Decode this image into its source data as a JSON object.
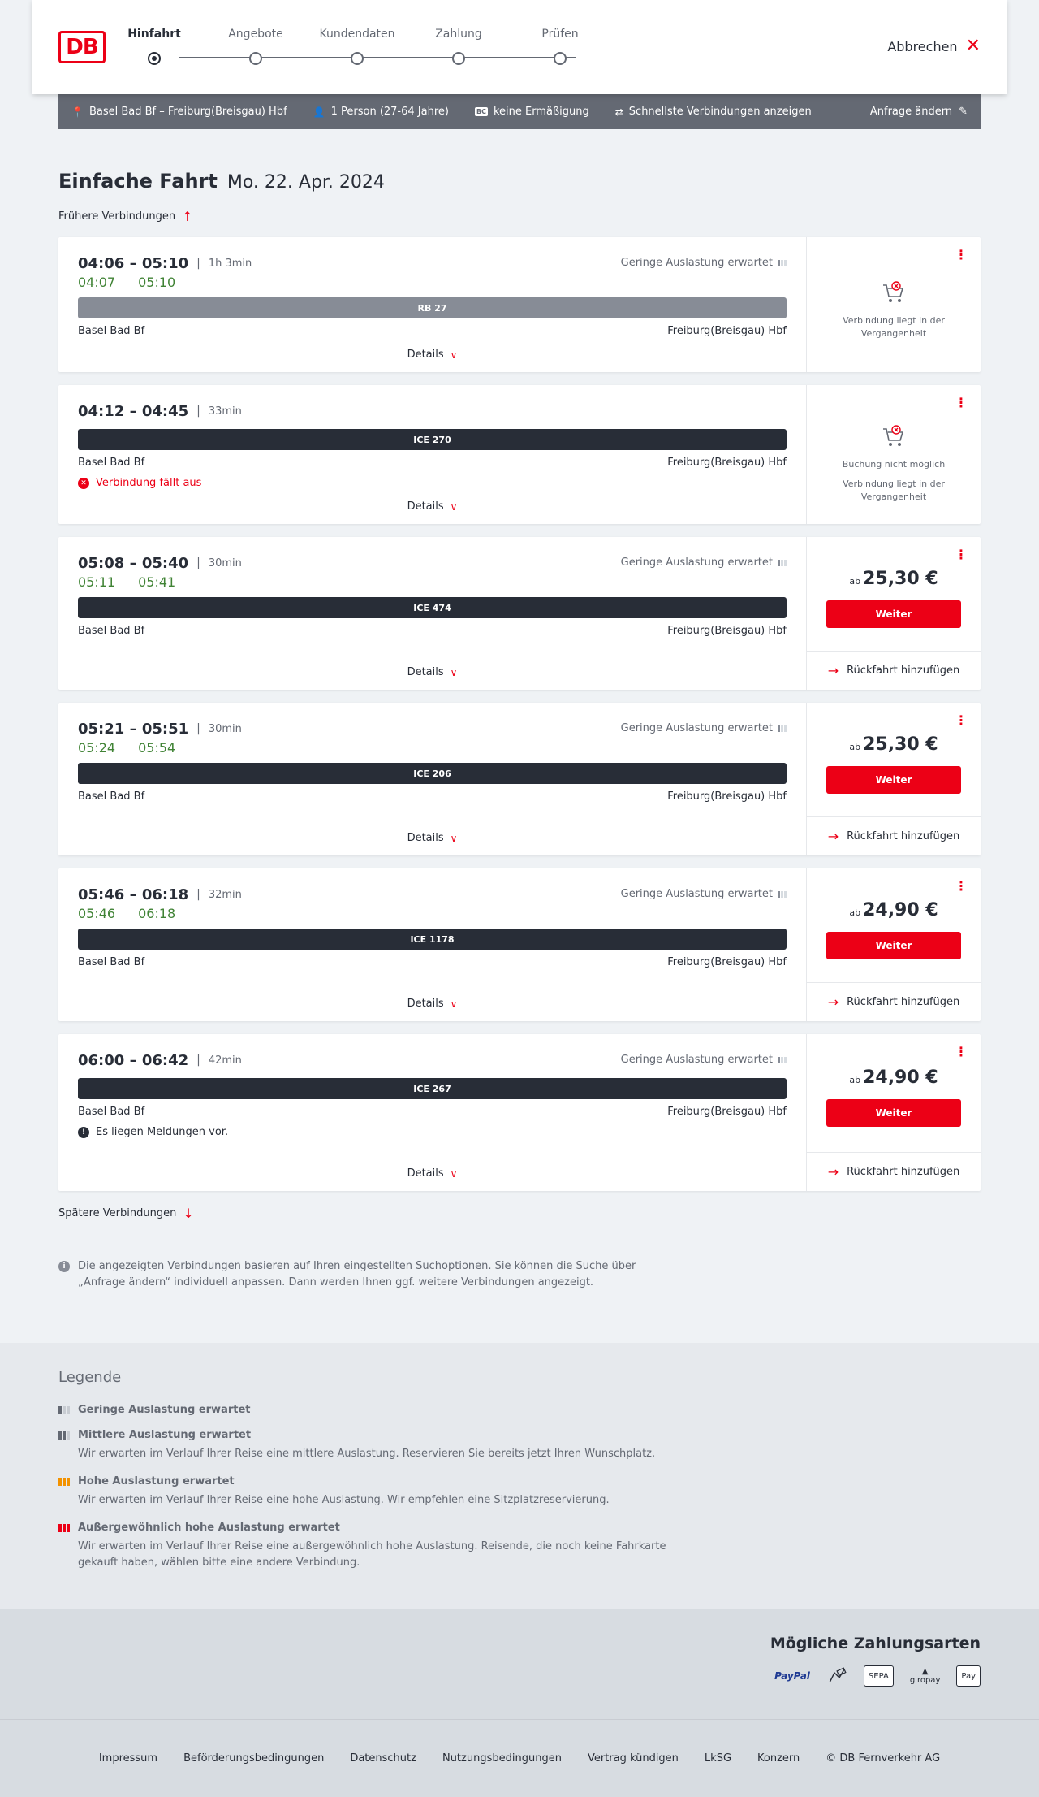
{
  "brand": {
    "logo_text": "DB",
    "accent_color": "#ec0016"
  },
  "stepper": {
    "steps": [
      "Hinfahrt",
      "Angebote",
      "Kundendaten",
      "Zahlung",
      "Prüfen"
    ],
    "active": 0
  },
  "header": {
    "cancel_label": "Abbrechen"
  },
  "search_summary": {
    "route": "Basel Bad Bf – Freiburg(Breisgau) Hbf",
    "passengers": "1 Person (27-64 Jahre)",
    "discount_badge": "BC",
    "discount": "keine Ermäßigung",
    "option": "Schnellste Verbindungen anzeigen",
    "edit_label": "Anfrage ändern"
  },
  "page": {
    "title": "Einfache Fahrt",
    "date": "Mo. 22. Apr. 2024",
    "earlier_label": "Frühere Verbindungen",
    "later_label": "Spätere Verbindungen",
    "note": "Die angezeigten Verbindungen basieren auf Ihren eingestellten Suchoptionen. Sie können die Suche über „Anfrage ändern“ individuell anpassen. Dann werden Ihnen ggf. weitere Verbindungen angezeigt."
  },
  "labels": {
    "details": "Details",
    "weiter": "Weiter",
    "return": "Rückfahrt hinzufügen",
    "price_prefix": "ab",
    "load": "Geringe Auslastung erwartet"
  },
  "connections": [
    {
      "times": "04:06 – 05:10",
      "duration": "1h 3min",
      "realtime_dep": "04:07",
      "realtime_arr": "05:10",
      "train": "RB 27",
      "from": "Basel Bad Bf",
      "to": "Freiburg(Breisgau) Hbf",
      "load": true,
      "message": "",
      "status_lines": [
        "Verbindung liegt in der Vergangenheit"
      ]
    },
    {
      "times": "04:12 – 04:45",
      "duration": "33min",
      "realtime_dep": "",
      "realtime_arr": "",
      "train": "ICE 270",
      "from": "Basel Bad Bf",
      "to": "Freiburg(Breisgau) Hbf",
      "load": false,
      "message": "Verbindung fällt aus",
      "status_lines": [
        "Buchung nicht möglich",
        "Verbindung liegt in der Vergangenheit"
      ]
    },
    {
      "times": "05:08 – 05:40",
      "duration": "30min",
      "realtime_dep": "05:11",
      "realtime_arr": "05:41",
      "train": "ICE 474",
      "from": "Basel Bad Bf",
      "to": "Freiburg(Breisgau) Hbf",
      "load": true,
      "message": "",
      "price": "25,30 €"
    },
    {
      "times": "05:21 – 05:51",
      "duration": "30min",
      "realtime_dep": "05:24",
      "realtime_arr": "05:54",
      "train": "ICE 206",
      "from": "Basel Bad Bf",
      "to": "Freiburg(Breisgau) Hbf",
      "load": true,
      "message": "",
      "price": "25,30 €"
    },
    {
      "times": "05:46 – 06:18",
      "duration": "32min",
      "realtime_dep": "05:46",
      "realtime_arr": "06:18",
      "train": "ICE 1178",
      "from": "Basel Bad Bf",
      "to": "Freiburg(Breisgau) Hbf",
      "load": true,
      "message": "",
      "price": "24,90 €"
    },
    {
      "times": "06:00 – 06:42",
      "duration": "42min",
      "realtime_dep": "",
      "realtime_arr": "",
      "train": "ICE 267",
      "from": "Basel Bad Bf",
      "to": "Freiburg(Breisgau) Hbf",
      "load": true,
      "message": "Es liegen Meldungen vor.",
      "price": "24,90 €"
    }
  ],
  "legend": {
    "title": "Legende",
    "items": [
      {
        "heading": "Geringe Auslastung erwartet",
        "text": "",
        "color": "#878c96"
      },
      {
        "heading": "Mittlere Auslastung erwartet",
        "text": "Wir erwarten im Verlauf Ihrer Reise eine mittlere Auslastung. Reservieren Sie bereits jetzt Ihren Wunschplatz.",
        "color": "#646973"
      },
      {
        "heading": "Hohe Auslastung erwartet",
        "text": "Wir erwarten im Verlauf Ihrer Reise eine hohe Auslastung. Wir empfehlen eine Sitzplatzreservierung.",
        "color": "#f39200"
      },
      {
        "heading": "Außergewöhnlich hohe Auslastung erwartet",
        "text": "Wir erwarten im Verlauf Ihrer Reise eine außergewöhnlich hohe Auslastung. Reisende, die noch keine Fahrkarte gekauft haben, wählen bitte eine andere Verbindung.",
        "color": "#ec0016"
      }
    ]
  },
  "payment": {
    "title": "Mögliche Zahlungsarten",
    "methods": [
      "PayPal",
      "Kreditkarte",
      "SEPA",
      "giropay",
      "Apple Pay"
    ],
    "icon_texts": {
      "paypal": "PayPal",
      "sepa": "SEPA",
      "giropay": "giropay",
      "applepay": "Pay"
    }
  },
  "footer": {
    "links": [
      "Impressum",
      "Beförderungsbedingungen",
      "Datenschutz",
      "Nutzungsbedingungen",
      "Vertrag kündigen",
      "LkSG",
      "Konzern",
      "© DB Fernverkehr AG"
    ]
  }
}
